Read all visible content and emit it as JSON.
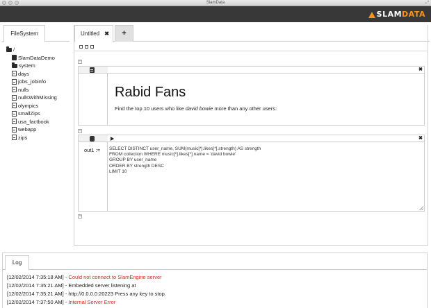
{
  "window": {
    "title": "SlamData"
  },
  "brand": {
    "slam": "SLAM",
    "data": "DATA",
    "accent": "#f7941d"
  },
  "filesystem": {
    "tab_label": "FileSystem",
    "root": "/",
    "items": [
      {
        "name": "SlamDataDemo",
        "icon": "database-icon"
      },
      {
        "name": "system",
        "icon": "folder-icon"
      },
      {
        "name": "days",
        "icon": "file-icon"
      },
      {
        "name": "jobs_jobinfo",
        "icon": "file-icon"
      },
      {
        "name": "nulls",
        "icon": "file-icon"
      },
      {
        "name": "nullsWithMissing",
        "icon": "file-icon"
      },
      {
        "name": "olympics",
        "icon": "file-icon"
      },
      {
        "name": "smallZips",
        "icon": "file-icon"
      },
      {
        "name": "usa_factbook",
        "icon": "file-icon"
      },
      {
        "name": "webapp",
        "icon": "file-icon"
      },
      {
        "name": "zips",
        "icon": "file-icon"
      }
    ]
  },
  "notebook": {
    "tab_label": "Untitled",
    "tab_close": "✖",
    "add_tab": "+",
    "cells": {
      "markdown": {
        "title": "Rabid Fans",
        "text_before": "Find the top 10 users who like ",
        "text_em": "david bowie",
        "text_after": " more than any other users:",
        "close": "✖"
      },
      "query": {
        "output_label": "out1 :=",
        "sql": "SELECT DISTINCT user_name, SUM(music[*].likes[*].strength) AS strength\nFROM collection WHERE music[*].likes[*].name = 'david bowie'\nGROUP BY user_name\nORDER BY strength DESC\nLIMIT 10",
        "close": "✖"
      }
    }
  },
  "log": {
    "tab_label": "Log",
    "lines": [
      {
        "time": "[12/02/2014 7:35:18 AM] - ",
        "msg": "Could not connect to SlamEngine server",
        "error": true
      },
      {
        "time": "[12/02/2014 7:35:21 AM] - ",
        "msg": "Embedded server listening at",
        "error": false
      },
      {
        "time": "[12/02/2014 7:35:21 AM] - ",
        "msg": "http://0.0.0.0:20223 Press any key to stop.",
        "error": false
      },
      {
        "time": "[12/02/2014 7:37:50 AM] - ",
        "msg": "Internal Server Error",
        "error": true
      }
    ]
  }
}
